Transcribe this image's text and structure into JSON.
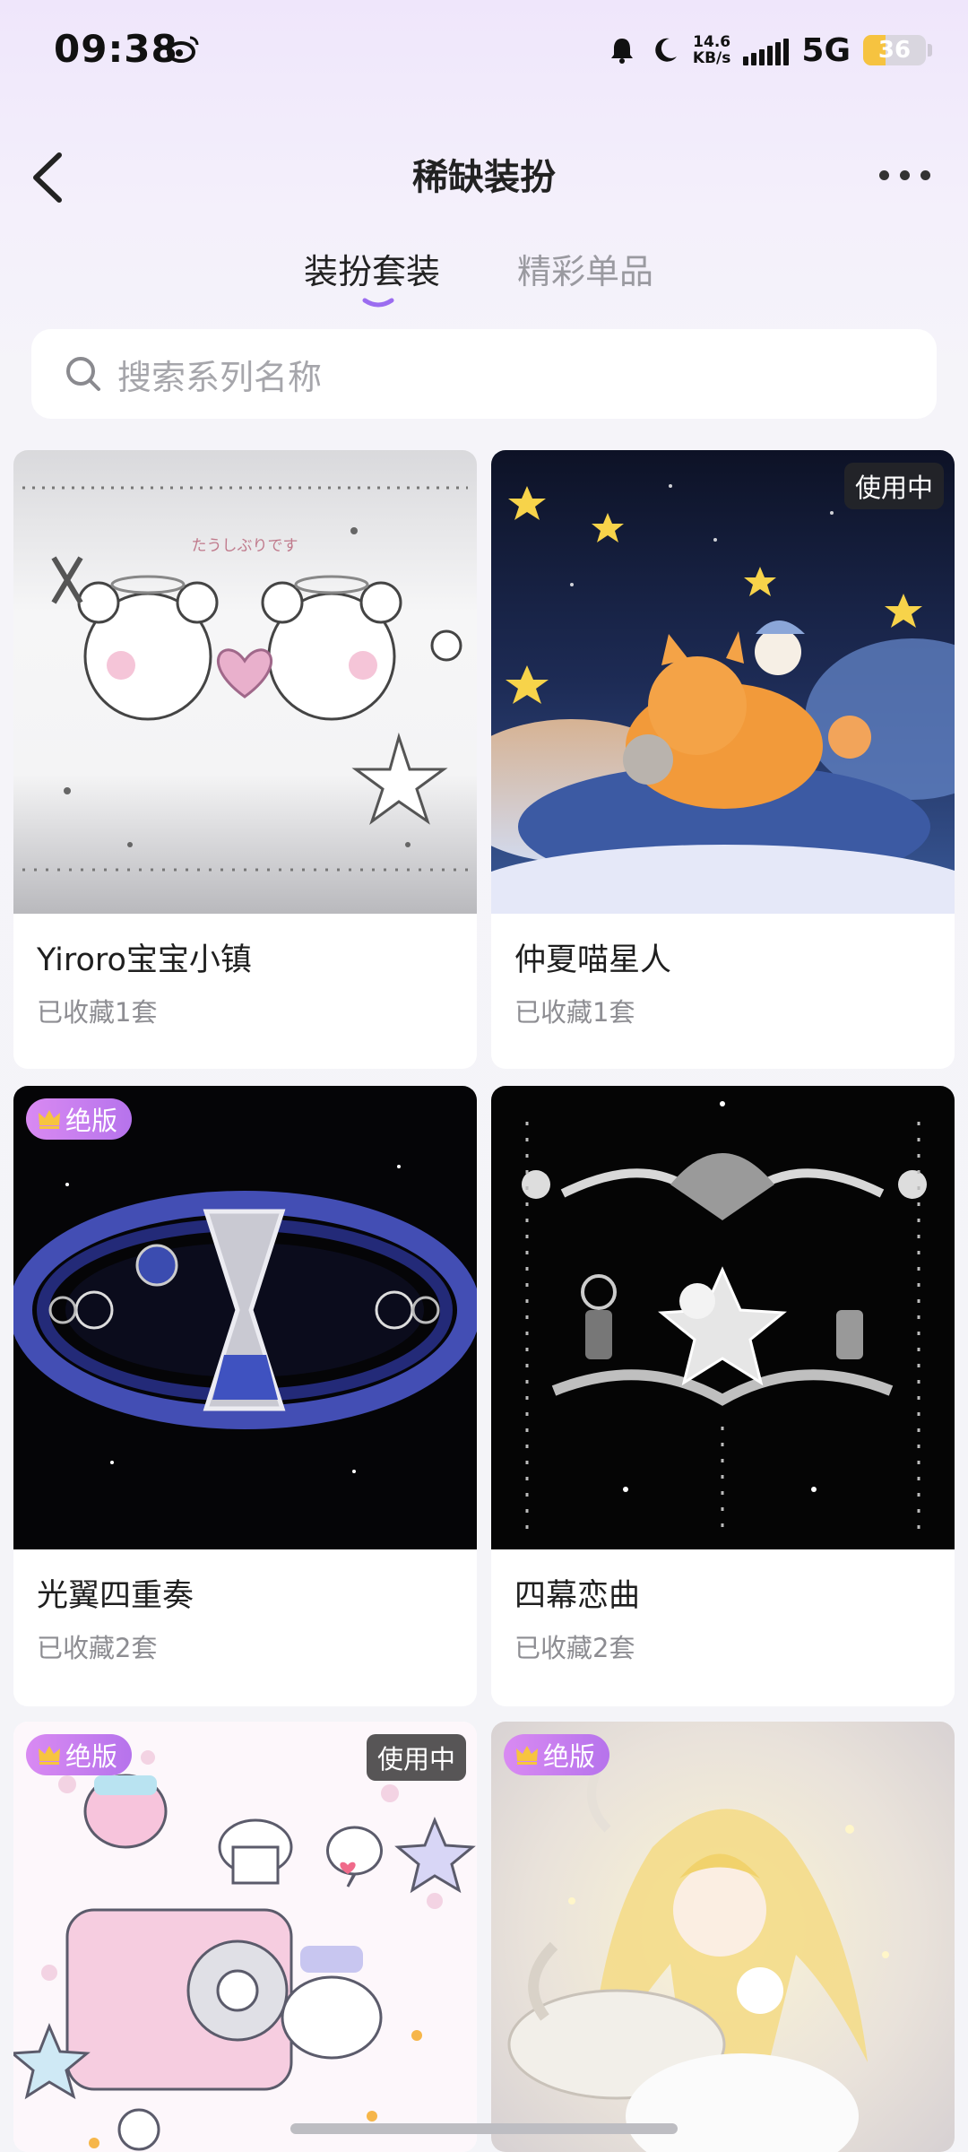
{
  "status_bar": {
    "time": "09:38",
    "net_speed_value": "14.6",
    "net_speed_unit": "KB/s",
    "network": "5G",
    "battery": "36",
    "battery_level": 0.36,
    "icons": [
      "weibo-icon",
      "bell-icon",
      "moon-icon",
      "signal-icon"
    ]
  },
  "header": {
    "title": "稀缺装扮",
    "back_icon": "chevron-left-icon",
    "more_icon": "more-icon"
  },
  "tabs": [
    {
      "label": "装扮套装",
      "active": true
    },
    {
      "label": "精彩单品",
      "active": false
    }
  ],
  "search": {
    "placeholder": "搜索系列名称",
    "icon": "search-icon"
  },
  "badges": {
    "in_use": "使用中",
    "limited": "绝版"
  },
  "items": [
    {
      "name": "Yiroro宝宝小镇",
      "collected": "已收藏1套",
      "in_use": false,
      "limited": false,
      "art": "たうしぶりです"
    },
    {
      "name": "仲夏喵星人",
      "collected": "已收藏1套",
      "in_use": true,
      "limited": false
    },
    {
      "name": "光翼四重奏",
      "collected": "已收藏2套",
      "in_use": false,
      "limited": true
    },
    {
      "name": "四幕恋曲",
      "collected": "已收藏2套",
      "in_use": false,
      "limited": false
    },
    {
      "name": "",
      "collected": "",
      "in_use": true,
      "limited": true
    },
    {
      "name": "",
      "collected": "",
      "in_use": false,
      "limited": true
    }
  ],
  "colors": {
    "accent": "#9b6cf0",
    "limited_badge": "#c47ff0",
    "battery": "#f6c340"
  }
}
